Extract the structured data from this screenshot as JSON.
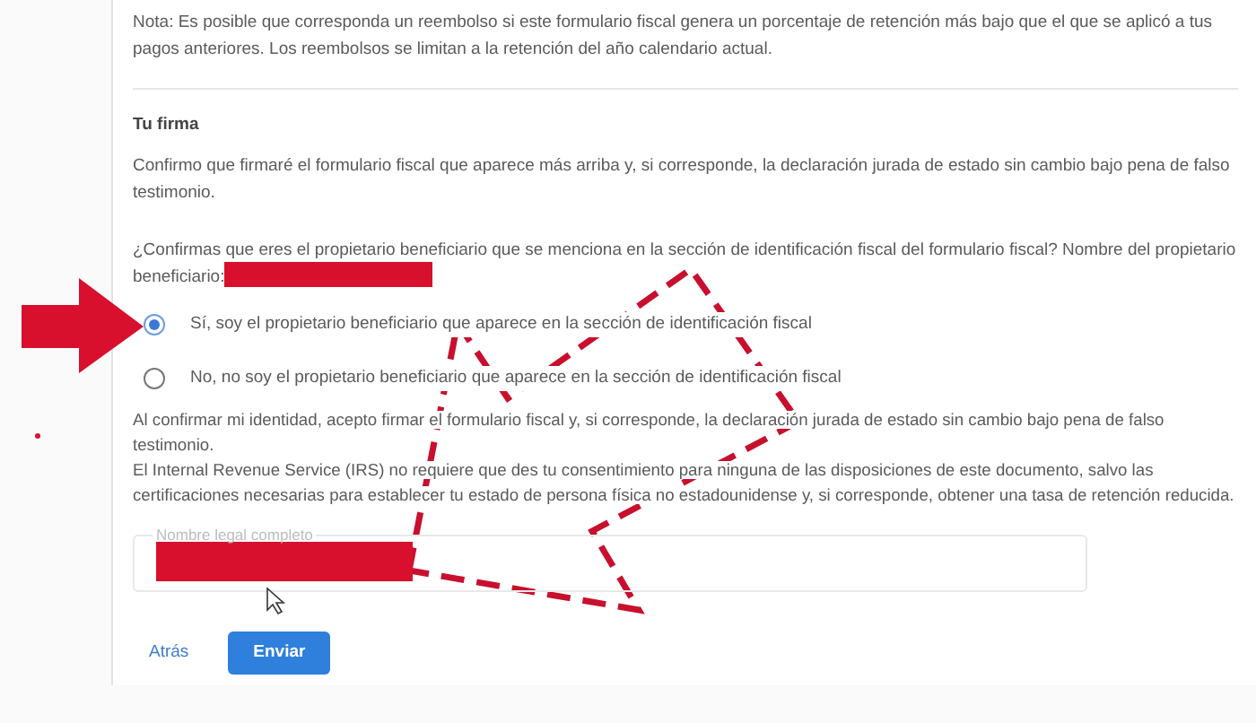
{
  "note": "Nota: Es posible que corresponda un reembolso si este formulario fiscal genera un porcentaje de retención más bajo que el que se aplicó a tus pagos anteriores. Los reembolsos se limitan a la retención del año calendario actual.",
  "signature": {
    "heading": "Tu firma",
    "confirmation": "Confirmo que firmaré el formulario fiscal que aparece más arriba y, si corresponde, la declaración jurada de estado sin cambio bajo pena de falso testimonio.",
    "question": "¿Confirmas que eres el propietario beneficiario que se menciona en la sección de identificación fiscal del formulario fiscal? Nombre del propietario beneficiario:",
    "options": [
      {
        "label": "Sí, soy el propietario beneficiario que aparece en la sección de identificación fiscal",
        "selected": true
      },
      {
        "label": "No, no soy el propietario beneficiario que aparece en la sección de identificación fiscal",
        "selected": false
      }
    ],
    "agreement": [
      "Al confirmar mi identidad, acepto firmar el formulario fiscal y, si corresponde, la declaración jurada de estado sin cambio bajo pena de falso testimonio.",
      "El Internal Revenue Service (IRS) no requiere que des tu consentimiento para ninguna de las disposiciones de este documento, salvo las certificaciones necesarias para establecer tu estado de persona física no estadounidense y, si corresponde, obtener una tasa de retención reducida."
    ],
    "name_field": {
      "label": "Nombre legal completo"
    }
  },
  "actions": {
    "back": "Atrás",
    "submit": "Enviar"
  }
}
